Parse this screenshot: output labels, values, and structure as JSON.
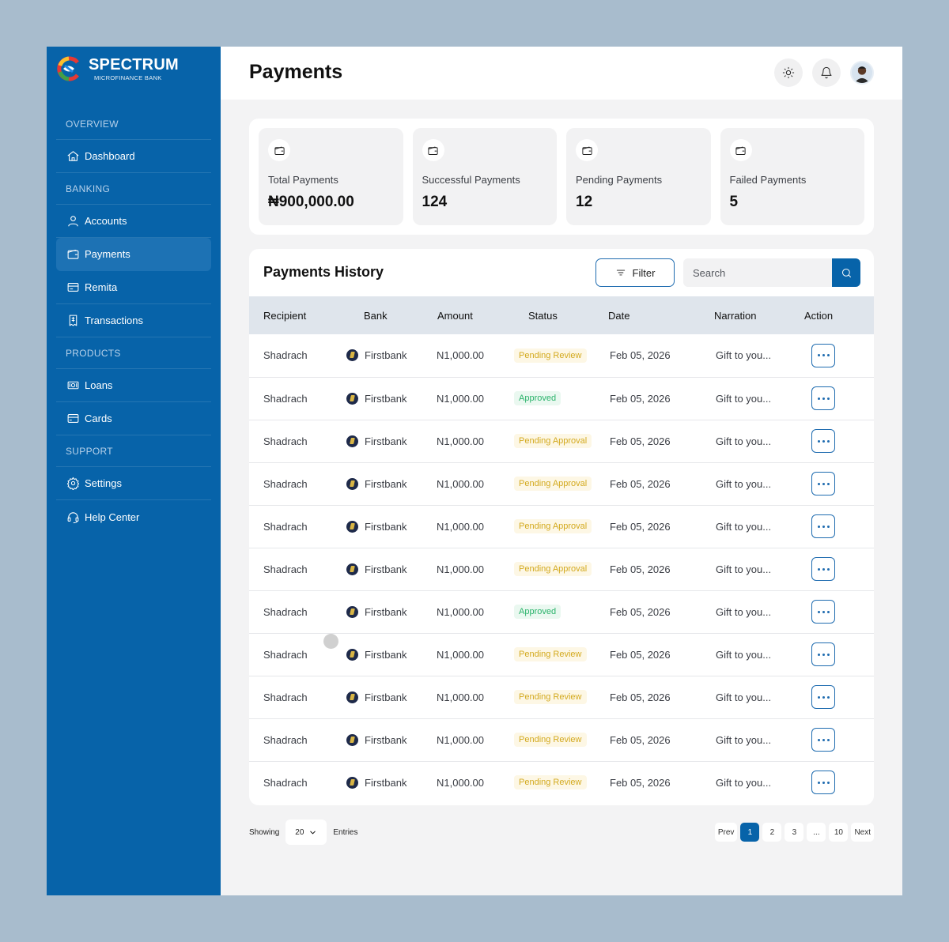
{
  "brand": {
    "name": "SPECTRUM",
    "subtitle": "MICROFINANCE BANK"
  },
  "sidebar": {
    "sections": [
      {
        "title": "OVERVIEW",
        "items": [
          {
            "label": "Dashboard",
            "icon": "home-icon"
          }
        ]
      },
      {
        "title": "BANKING",
        "items": [
          {
            "label": "Accounts",
            "icon": "user-icon"
          },
          {
            "label": "Payments",
            "icon": "wallet-icon",
            "active": true
          },
          {
            "label": "Remita",
            "icon": "card-icon"
          },
          {
            "label": "Transactions",
            "icon": "receipt-icon"
          }
        ]
      },
      {
        "title": "PRODUCTS",
        "items": [
          {
            "label": "Loans",
            "icon": "cash-icon"
          },
          {
            "label": "Cards",
            "icon": "credit-card-icon"
          }
        ]
      },
      {
        "title": "SUPPORT",
        "items": [
          {
            "label": "Settings",
            "icon": "gear-icon"
          },
          {
            "label": "Help Center",
            "icon": "headset-icon"
          }
        ]
      }
    ]
  },
  "header": {
    "title": "Payments"
  },
  "stats": [
    {
      "label": "Total Payments",
      "value": "₦900,000.00"
    },
    {
      "label": "Successful Payments",
      "value": "124"
    },
    {
      "label": "Pending Payments",
      "value": "12"
    },
    {
      "label": "Failed Payments",
      "value": "5"
    }
  ],
  "history": {
    "title": "Payments History",
    "filter_label": "Filter",
    "search_placeholder": "Search",
    "columns": [
      "Recipient",
      "Bank",
      "Amount",
      "Status",
      "Date",
      "Narration",
      "Action"
    ],
    "rows": [
      {
        "recipient": "Shadrach",
        "bank": "Firstbank",
        "amount": "N1,000.00",
        "status": "Pending Review",
        "status_type": "review",
        "date": "Feb 05, 2026",
        "narration": "Gift to you..."
      },
      {
        "recipient": "Shadrach",
        "bank": "Firstbank",
        "amount": "N1,000.00",
        "status": "Approved",
        "status_type": "approved",
        "date": "Feb 05, 2026",
        "narration": "Gift to you..."
      },
      {
        "recipient": "Shadrach",
        "bank": "Firstbank",
        "amount": "N1,000.00",
        "status": "Pending Approval",
        "status_type": "approval",
        "date": "Feb 05, 2026",
        "narration": "Gift to you..."
      },
      {
        "recipient": "Shadrach",
        "bank": "Firstbank",
        "amount": "N1,000.00",
        "status": "Pending Approval",
        "status_type": "approval",
        "date": "Feb 05, 2026",
        "narration": "Gift to you..."
      },
      {
        "recipient": "Shadrach",
        "bank": "Firstbank",
        "amount": "N1,000.00",
        "status": "Pending Approval",
        "status_type": "approval",
        "date": "Feb 05, 2026",
        "narration": "Gift to you..."
      },
      {
        "recipient": "Shadrach",
        "bank": "Firstbank",
        "amount": "N1,000.00",
        "status": "Pending Approval",
        "status_type": "approval",
        "date": "Feb 05, 2026",
        "narration": "Gift to you..."
      },
      {
        "recipient": "Shadrach",
        "bank": "Firstbank",
        "amount": "N1,000.00",
        "status": "Approved",
        "status_type": "approved",
        "date": "Feb 05, 2026",
        "narration": "Gift to you..."
      },
      {
        "recipient": "Shadrach",
        "bank": "Firstbank",
        "amount": "N1,000.00",
        "status": "Pending Review",
        "status_type": "review",
        "date": "Feb 05, 2026",
        "narration": "Gift to you..."
      },
      {
        "recipient": "Shadrach",
        "bank": "Firstbank",
        "amount": "N1,000.00",
        "status": "Pending Review",
        "status_type": "review",
        "date": "Feb 05, 2026",
        "narration": "Gift to you..."
      },
      {
        "recipient": "Shadrach",
        "bank": "Firstbank",
        "amount": "N1,000.00",
        "status": "Pending Review",
        "status_type": "review",
        "date": "Feb 05, 2026",
        "narration": "Gift to you..."
      },
      {
        "recipient": "Shadrach",
        "bank": "Firstbank",
        "amount": "N1,000.00",
        "status": "Pending Review",
        "status_type": "review",
        "date": "Feb 05, 2026",
        "narration": "Gift to you..."
      }
    ]
  },
  "footer": {
    "showing_label": "Showing",
    "entries_value": "20",
    "entries_label": "Entries",
    "pagination": [
      "Prev",
      "1",
      "2",
      "3",
      "...",
      "10",
      "Next"
    ],
    "active_page": "1"
  },
  "colors": {
    "primary": "#0763a9",
    "pending": "#d3a91d",
    "approved": "#2bb36b"
  }
}
